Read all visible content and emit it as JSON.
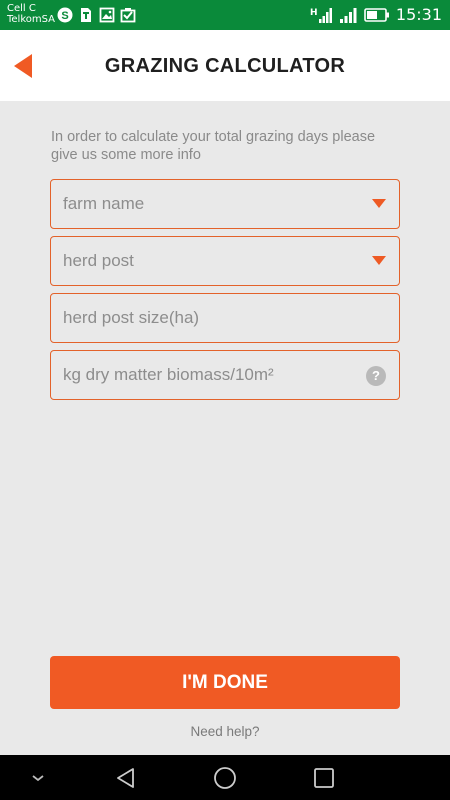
{
  "status_bar": {
    "carrier_line1": "Cell C",
    "carrier_line2": "TelkomSA",
    "time": "15:31",
    "network_label": "H",
    "icons": [
      "skype-icon",
      "sim-toolkit-icon",
      "image-icon",
      "task-check-icon",
      "signal-icon",
      "signal-icon",
      "battery-icon"
    ]
  },
  "header": {
    "title": "GRAZING CALCULATOR",
    "back_icon": "back-arrow-icon",
    "accent_color": "#f05a24"
  },
  "form": {
    "intro_text": "In order to calculate your total grazing days please give us some more info",
    "fields": [
      {
        "placeholder": "farm name",
        "type": "dropdown"
      },
      {
        "placeholder": "herd post",
        "type": "dropdown"
      },
      {
        "placeholder": "herd post size(ha)",
        "type": "text"
      },
      {
        "placeholder": "kg dry matter biomass/10m²",
        "type": "text",
        "help_symbol": "?"
      }
    ],
    "submit_label": "I'M DONE",
    "help_link": "Need help?"
  },
  "nav_bar": {
    "items": [
      "collapse-icon",
      "back-triangle-icon",
      "home-circle-icon",
      "recents-square-icon"
    ]
  }
}
